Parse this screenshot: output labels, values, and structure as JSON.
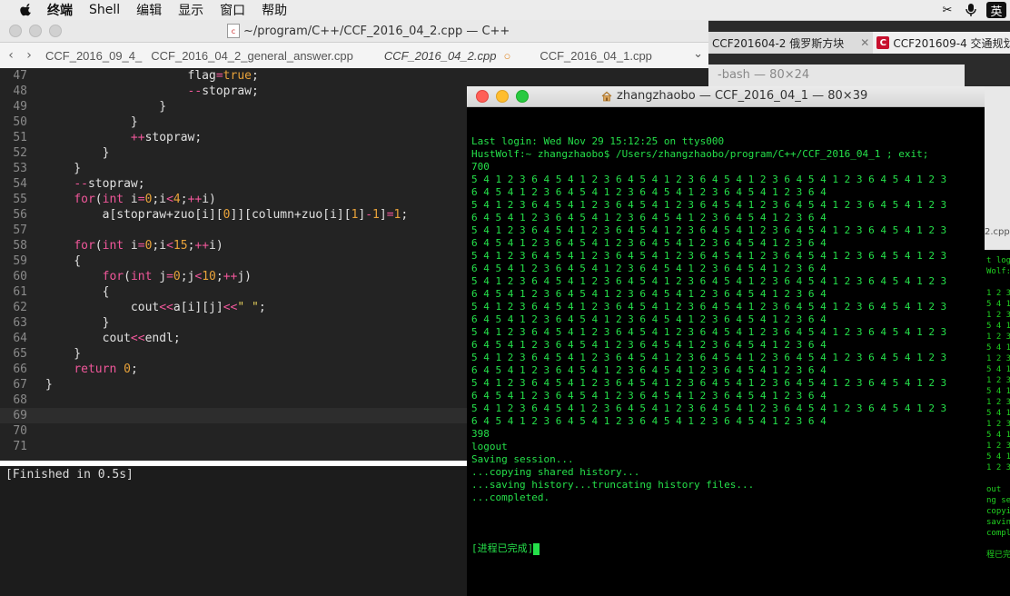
{
  "menubar": {
    "app": "终端",
    "items": [
      "Shell",
      "编辑",
      "显示",
      "窗口",
      "帮助"
    ],
    "ime": "英"
  },
  "editor": {
    "title": "~/program/C++/CCF_2016_04_2.cpp — C++",
    "tabs": [
      {
        "label": "CCF_2016_09_4_"
      },
      {
        "label": "CCF_2016_04_2_general_answer.cpp"
      },
      {
        "label": "CCF_2016_04_2.cpp",
        "active": true
      },
      {
        "label": "CCF_2016_04_1.cpp"
      }
    ],
    "output": "[Finished in 0.5s]"
  },
  "code_lines": [
    {
      "n": "47",
      "text": "                    flag=true;"
    },
    {
      "n": "48",
      "text": "                    --stopraw;"
    },
    {
      "n": "49",
      "text": "                }"
    },
    {
      "n": "50",
      "text": "            }"
    },
    {
      "n": "51",
      "text": "            ++stopraw;"
    },
    {
      "n": "52",
      "text": "        }"
    },
    {
      "n": "53",
      "text": "    }"
    },
    {
      "n": "54",
      "text": "    --stopraw;"
    },
    {
      "n": "55",
      "text": "    for(int i=0;i<4;++i)"
    },
    {
      "n": "56",
      "text": "        a[stopraw+zuo[i][0]][column+zuo[i][1]-1]=1;"
    },
    {
      "n": "57",
      "text": ""
    },
    {
      "n": "58",
      "text": "    for(int i=0;i<15;++i)"
    },
    {
      "n": "59",
      "text": "    {"
    },
    {
      "n": "60",
      "text": "        for(int j=0;j<10;++j)"
    },
    {
      "n": "61",
      "text": "        {"
    },
    {
      "n": "62",
      "text": "            cout<<a[i][j]<<\" \";"
    },
    {
      "n": "63",
      "text": "        }"
    },
    {
      "n": "64",
      "text": "        cout<<endl;"
    },
    {
      "n": "65",
      "text": "    }"
    },
    {
      "n": "66",
      "text": "    return 0;"
    },
    {
      "n": "67",
      "text": "}"
    },
    {
      "n": "68",
      "text": ""
    },
    {
      "n": "69",
      "text": ""
    },
    {
      "n": "70",
      "text": ""
    },
    {
      "n": "71",
      "text": ""
    }
  ],
  "background": {
    "chrome_tab1": "CCF201604-2 俄罗斯方块",
    "chrome_tab2": "CCF201609-4 交通规划",
    "bash_title": "-bash — 80×24",
    "side_label": "2.cpp",
    "side_term": "t logi\nWolf:~\n\n1 2 3\n5 4 1\n1 2 3\n5 4 1\n1 2 3\n5 4 1\n1 2 3\n5 4 1\n1 2 3\n5 4 1\n1 2 3\n5 4 1\n1 2 3\n5 4 1\n1 2 3\n5 4 1\n1 2 3\n\nout\nng se\ncopyin\nsaving\ncomple\n\n程已完"
  },
  "terminal": {
    "title": "zhangzhaobo — CCF_2016_04_1 — 80×39",
    "lines": [
      "Last login: Wed Nov 29 15:12:25 on ttys000",
      "HustWolf:~ zhangzhaobo$ /Users/zhangzhaobo/program/C++/CCF_2016_04_1 ; exit;",
      "700",
      "5 4 1 2 3 6 4 5 4 1 2 3 6 4 5 4 1 2 3 6 4 5 4 1 2 3 6 4 5 4 1 2 3 6 4 5 4 1 2 3",
      "6 4 5 4 1 2 3 6 4 5 4 1 2 3 6 4 5 4 1 2 3 6 4 5 4 1 2 3 6 4",
      "5 4 1 2 3 6 4 5 4 1 2 3 6 4 5 4 1 2 3 6 4 5 4 1 2 3 6 4 5 4 1 2 3 6 4 5 4 1 2 3",
      "6 4 5 4 1 2 3 6 4 5 4 1 2 3 6 4 5 4 1 2 3 6 4 5 4 1 2 3 6 4",
      "5 4 1 2 3 6 4 5 4 1 2 3 6 4 5 4 1 2 3 6 4 5 4 1 2 3 6 4 5 4 1 2 3 6 4 5 4 1 2 3",
      "6 4 5 4 1 2 3 6 4 5 4 1 2 3 6 4 5 4 1 2 3 6 4 5 4 1 2 3 6 4",
      "5 4 1 2 3 6 4 5 4 1 2 3 6 4 5 4 1 2 3 6 4 5 4 1 2 3 6 4 5 4 1 2 3 6 4 5 4 1 2 3",
      "6 4 5 4 1 2 3 6 4 5 4 1 2 3 6 4 5 4 1 2 3 6 4 5 4 1 2 3 6 4",
      "5 4 1 2 3 6 4 5 4 1 2 3 6 4 5 4 1 2 3 6 4 5 4 1 2 3 6 4 5 4 1 2 3 6 4 5 4 1 2 3",
      "6 4 5 4 1 2 3 6 4 5 4 1 2 3 6 4 5 4 1 2 3 6 4 5 4 1 2 3 6 4",
      "5 4 1 2 3 6 4 5 4 1 2 3 6 4 5 4 1 2 3 6 4 5 4 1 2 3 6 4 5 4 1 2 3 6 4 5 4 1 2 3",
      "6 4 5 4 1 2 3 6 4 5 4 1 2 3 6 4 5 4 1 2 3 6 4 5 4 1 2 3 6 4",
      "5 4 1 2 3 6 4 5 4 1 2 3 6 4 5 4 1 2 3 6 4 5 4 1 2 3 6 4 5 4 1 2 3 6 4 5 4 1 2 3",
      "6 4 5 4 1 2 3 6 4 5 4 1 2 3 6 4 5 4 1 2 3 6 4 5 4 1 2 3 6 4",
      "5 4 1 2 3 6 4 5 4 1 2 3 6 4 5 4 1 2 3 6 4 5 4 1 2 3 6 4 5 4 1 2 3 6 4 5 4 1 2 3",
      "6 4 5 4 1 2 3 6 4 5 4 1 2 3 6 4 5 4 1 2 3 6 4 5 4 1 2 3 6 4",
      "5 4 1 2 3 6 4 5 4 1 2 3 6 4 5 4 1 2 3 6 4 5 4 1 2 3 6 4 5 4 1 2 3 6 4 5 4 1 2 3",
      "6 4 5 4 1 2 3 6 4 5 4 1 2 3 6 4 5 4 1 2 3 6 4 5 4 1 2 3 6 4",
      "5 4 1 2 3 6 4 5 4 1 2 3 6 4 5 4 1 2 3 6 4 5 4 1 2 3 6 4 5 4 1 2 3 6 4 5 4 1 2 3",
      "6 4 5 4 1 2 3 6 4 5 4 1 2 3 6 4 5 4 1 2 3 6 4 5 4 1 2 3 6 4",
      "398",
      "logout",
      "Saving session...",
      "...copying shared history...",
      "...saving history...truncating history files...",
      "...completed.",
      ""
    ],
    "final_line": "[进程已完成]"
  }
}
